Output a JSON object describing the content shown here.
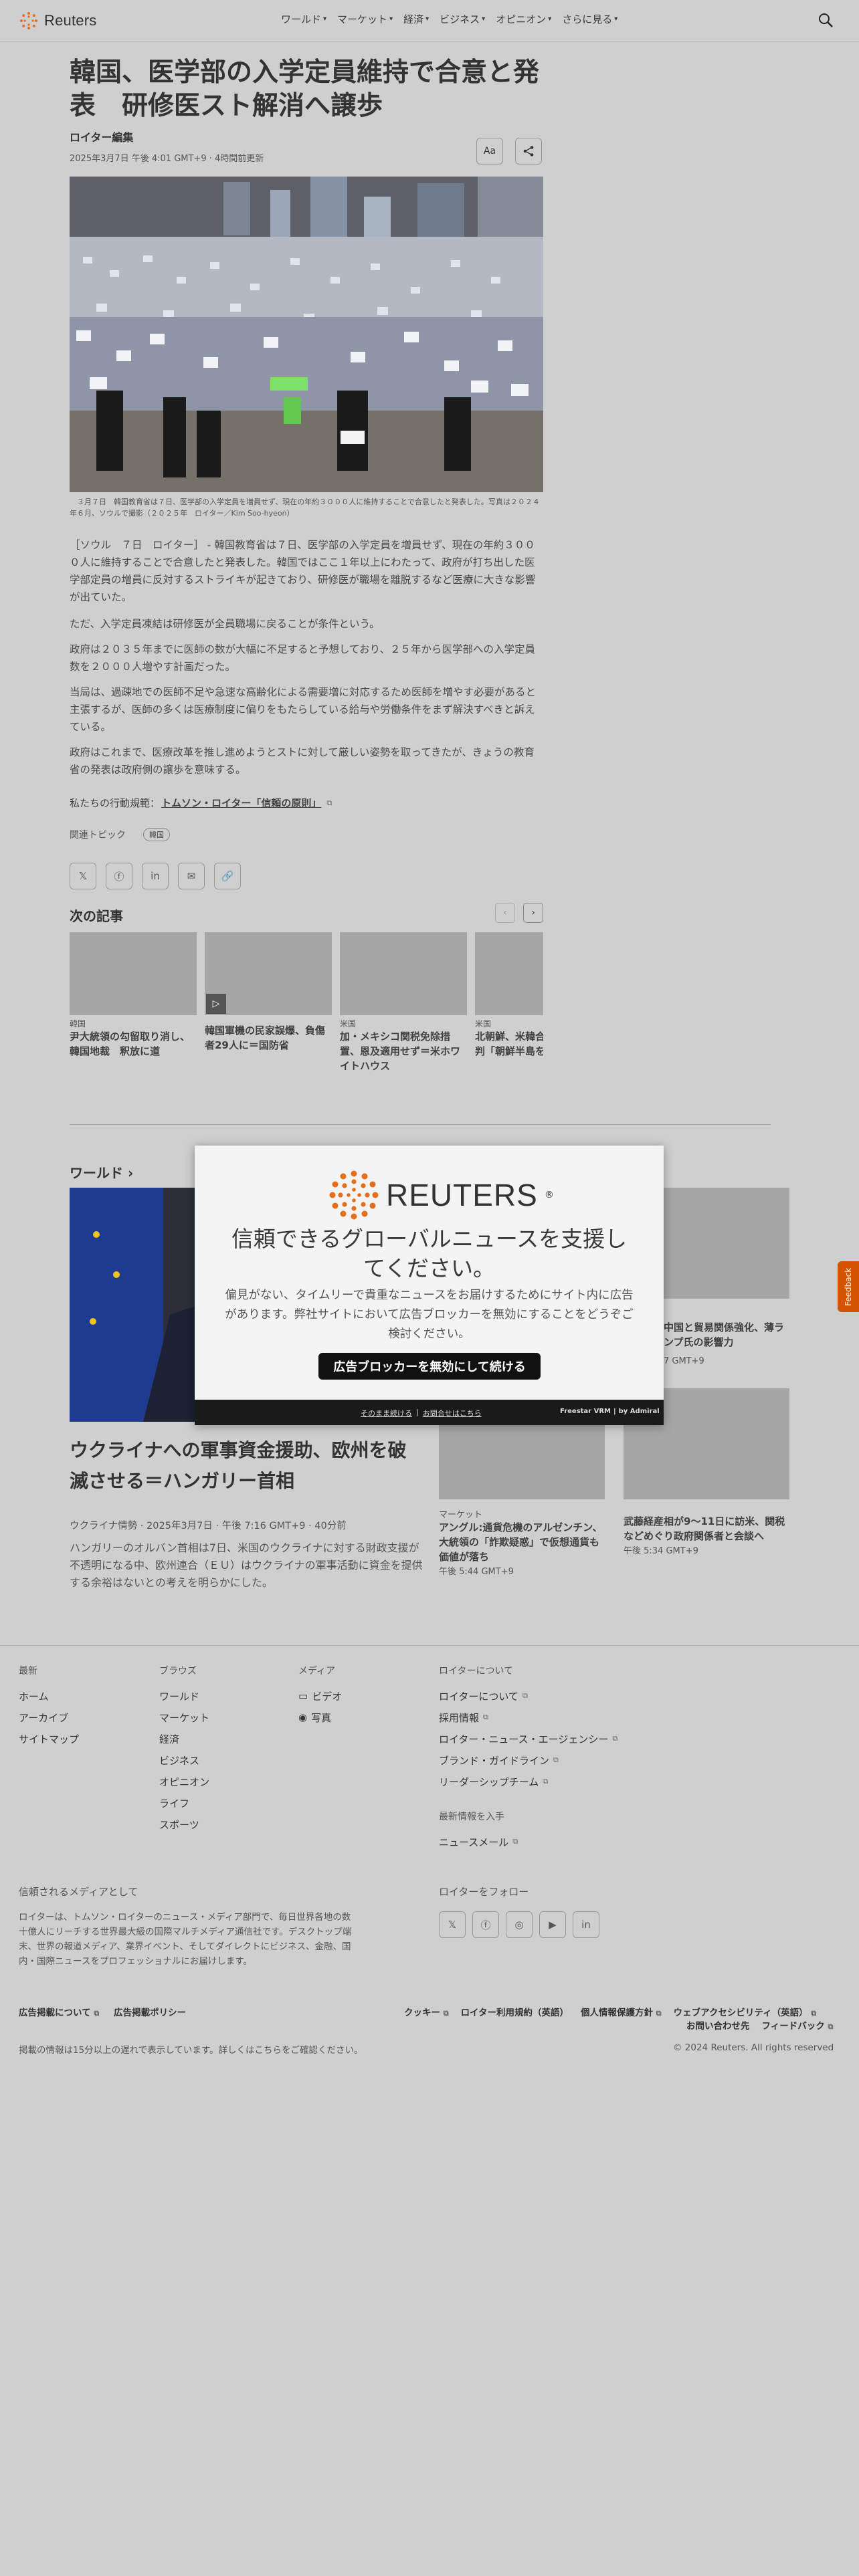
{
  "header": {
    "brand": "Reuters",
    "nav": [
      "ワールド",
      "マーケット",
      "経済",
      "ビジネス",
      "オピニオン",
      "さらに見る"
    ]
  },
  "article": {
    "title": "韓国、医学部の入学定員維持で合意と発表　研修医スト解消へ譲歩",
    "byline": "ロイター編集",
    "dateline": "2025年3月7日 午後 4:01 GMT+9 · 4時間前更新",
    "font_button": "Aa",
    "caption": "　３月７日　韓国教育省は７日、医学部の入学定員を増員せず、現在の年約３０００人に維持することで合意したと発表した。写真は２０２４年６月、ソウルで撮影（２０２５年　ロイター／Kim Soo-hyeon）",
    "paragraphs": [
      "［ソウル　７日　ロイター］ - 韓国教育省は７日、医学部の入学定員を増員せず、現在の年約３０００人に維持することで合意したと発表した。韓国ではここ１年以上にわたって、政府が打ち出した医学部定員の増員に反対するストライキが起きており、研修医が職場を離脱するなど医療に大きな影響が出ていた。",
      "ただ、入学定員凍結は研修医が全員職場に戻ることが条件という。",
      "政府は２０３５年までに医師の数が大幅に不足すると予想しており、２５年から医学部への入学定員数を２０００人増やす計画だった。",
      "当局は、過疎地での医師不足や急速な高齢化による需要増に対応するため医師を増やす必要があると主張するが、医師の多くは医療制度に偏りをもたらしている給与や労働条件をまず解決すべきと訴えている。",
      "政府はこれまで、医療改革を推し進めようとストに対して厳しい姿勢を取ってきたが、きょうの教育省の発表は政府側の譲歩を意味する。"
    ],
    "principles_prefix": "私たちの行動規範：",
    "principles_link": "トムソン・ロイター「信頼の原則」",
    "topic_label": "関連トピック",
    "topic_chip": "韓国"
  },
  "next_articles": {
    "label": "次の記事",
    "items": [
      {
        "category": "韓国",
        "title": "尹大統領の勾留取り消し、韓国地裁　釈放に道"
      },
      {
        "category": "",
        "title": "韓国軍機の民家誤爆、負傷者29人に＝国防省"
      },
      {
        "category": "米国",
        "title": "加・メキシコ関税免除措置、恩及適用せず＝米ホワイトハウス"
      },
      {
        "category": "米国",
        "title": "北朝鮮、米韓合同演習を批判「朝鮮半島を悪化させる」"
      }
    ]
  },
  "world_section": {
    "label": "ワールド",
    "main_title": "ウクライナへの軍事資金援助、欧州を破滅させる＝ハンガリー首相",
    "main_meta": "ウクライナ情勢 · 2025年3月7日 · 午後 7:16 GMT+9 · 40分前",
    "main_desc": "ハンガリーのオルバン首相は7日、米国のウクライナに対する財政支援が不透明になる中、欧州連合（ＥＵ）はウクライナの軍事活動に資金を提供する余裕はないとの考えを明らかにした。",
    "side_top_title": "中国と貿易関係強化、薄ランプ氏の影響力",
    "side_top_time": "7 GMT+9",
    "side_items": [
      {
        "category": "マーケット",
        "title": "アングル:通貨危機のアルゼンチン、大統領の「詐欺疑惑」で仮想通貨も価値が落ち",
        "time": "午後 5:44 GMT+9"
      },
      {
        "category": "",
        "title": "武藤経産相が9～11日に訪米、関税などめぐり政府関係者と会談へ",
        "time": "午後 5:34 GMT+9"
      }
    ]
  },
  "modal": {
    "brand": "REUTERS",
    "headline": "信頼できるグローバルニュースを支援してください。",
    "body": "偏見がない、タイムリーで貴重なニュースをお届けするためにサイト内に広告があります。弊社サイトにおいて広告ブロッカーを無効にすることをどうぞご検討ください。",
    "button": "広告ブロッカーを無効にして続ける",
    "continue_link": "そのまま続ける",
    "contact_link": "お問合せはこちら",
    "footer_credit": "Freestar VRM",
    "footer_by": "by Admiral"
  },
  "feedback": "Feedback",
  "footer": {
    "columns": [
      {
        "heading": "最新",
        "items": [
          "ホーム",
          "アーカイブ",
          "サイトマップ"
        ]
      },
      {
        "heading": "ブラウズ",
        "items": [
          "ワールド",
          "マーケット",
          "経済",
          "ビジネス",
          "オピニオン",
          "ライフ",
          "スポーツ"
        ]
      },
      {
        "heading": "メディア",
        "items": [
          "ビデオ",
          "写真"
        ]
      },
      {
        "heading": "ロイターについて",
        "items": [
          "ロイターについて",
          "採用情報",
          "ロイター・ニュース・エージェンシー",
          "ブランド・ガイドライン",
          "リーダーシップチーム"
        ]
      }
    ],
    "news_heading": "最新情報を入手",
    "news_item": "ニュースメール",
    "trust_heading": "信頼されるメディアとして",
    "trust_text": "ロイターは、トムソン・ロイターのニュース・メディア部門で、毎日世界各地の数十億人にリーチする世界最大級の国際マルチメディア通信社です。デスクトップ端末、世界の報道メディア、業界イベント、そしてダイレクトにビジネス、金融、国内・国際ニュースをプロフェッショナルにお届けします。",
    "follow_heading": "ロイターをフォロー",
    "legal_left": [
      "広告掲載について",
      "広告掲載ポリシー"
    ],
    "legal_right": [
      "クッキー",
      "ロイター利用規約（英語）",
      "個人情報保護方針",
      "ウェブアクセシビリティ（英語）"
    ],
    "legal_right2": [
      "お問い合わせ先",
      "フィードバック"
    ],
    "delay_note": "掲載の情報は15分以上の遅れで表示しています。詳しくはこちらをご確認ください。",
    "copyright": "© 2024 Reuters. All rights reserved"
  }
}
